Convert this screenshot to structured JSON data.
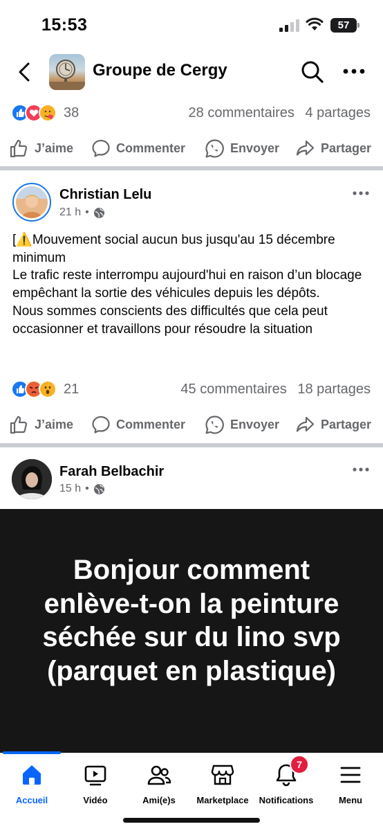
{
  "status_bar": {
    "time": "15:53",
    "battery": "57"
  },
  "header": {
    "title": "Groupe de Cergy",
    "back_icon": "chevron-left-icon",
    "search_icon": "search-icon",
    "more_icon": "more-horizontal-icon"
  },
  "post_prev": {
    "reactions": {
      "count": "38",
      "types": [
        "like",
        "love",
        "care"
      ]
    },
    "comments": "28 commentaires",
    "shares": "4 partages"
  },
  "actions": {
    "like": "J’aime",
    "comment": "Commenter",
    "send": "Envoyer",
    "share": "Partager"
  },
  "post1": {
    "author": "Christian Lelu",
    "time": "21 h",
    "privacy_icon": "globe-icon",
    "body_lines": [
      "[⚠️Mouvement social aucun bus jusqu'au 15 décembre minimum",
      "Le trafic reste interrompu aujourd'hui en raison d’un blocage empêchant la sortie des véhicules depuis les dépôts.",
      "Nous sommes conscients des difficultés que cela peut occasionner et travaillons pour résoudre la situation"
    ],
    "reactions": {
      "count": "21",
      "types": [
        "like",
        "angry",
        "wow"
      ]
    },
    "comments": "45 commentaires",
    "shares": "18 partages"
  },
  "post2": {
    "author": "Farah Belbachir",
    "time": "15 h",
    "privacy_icon": "globe-icon",
    "background_text": "Bonjour comment enlève-t-on la peinture séchée sur du lino svp (parquet en plastique)",
    "background_color": "#161616"
  },
  "bottom_nav": {
    "items": [
      {
        "label": "Accueil",
        "icon": "home-icon",
        "active": true
      },
      {
        "label": "Vidéo",
        "icon": "video-icon"
      },
      {
        "label": "Ami(e)s",
        "icon": "friends-icon"
      },
      {
        "label": "Marketplace",
        "icon": "marketplace-icon"
      },
      {
        "label": "Notifications",
        "icon": "bell-icon",
        "badge": "7"
      },
      {
        "label": "Menu",
        "icon": "menu-icon"
      }
    ]
  },
  "colors": {
    "accent": "#0866ff",
    "secondary_text": "#65676b",
    "badge": "#e41e3f"
  }
}
